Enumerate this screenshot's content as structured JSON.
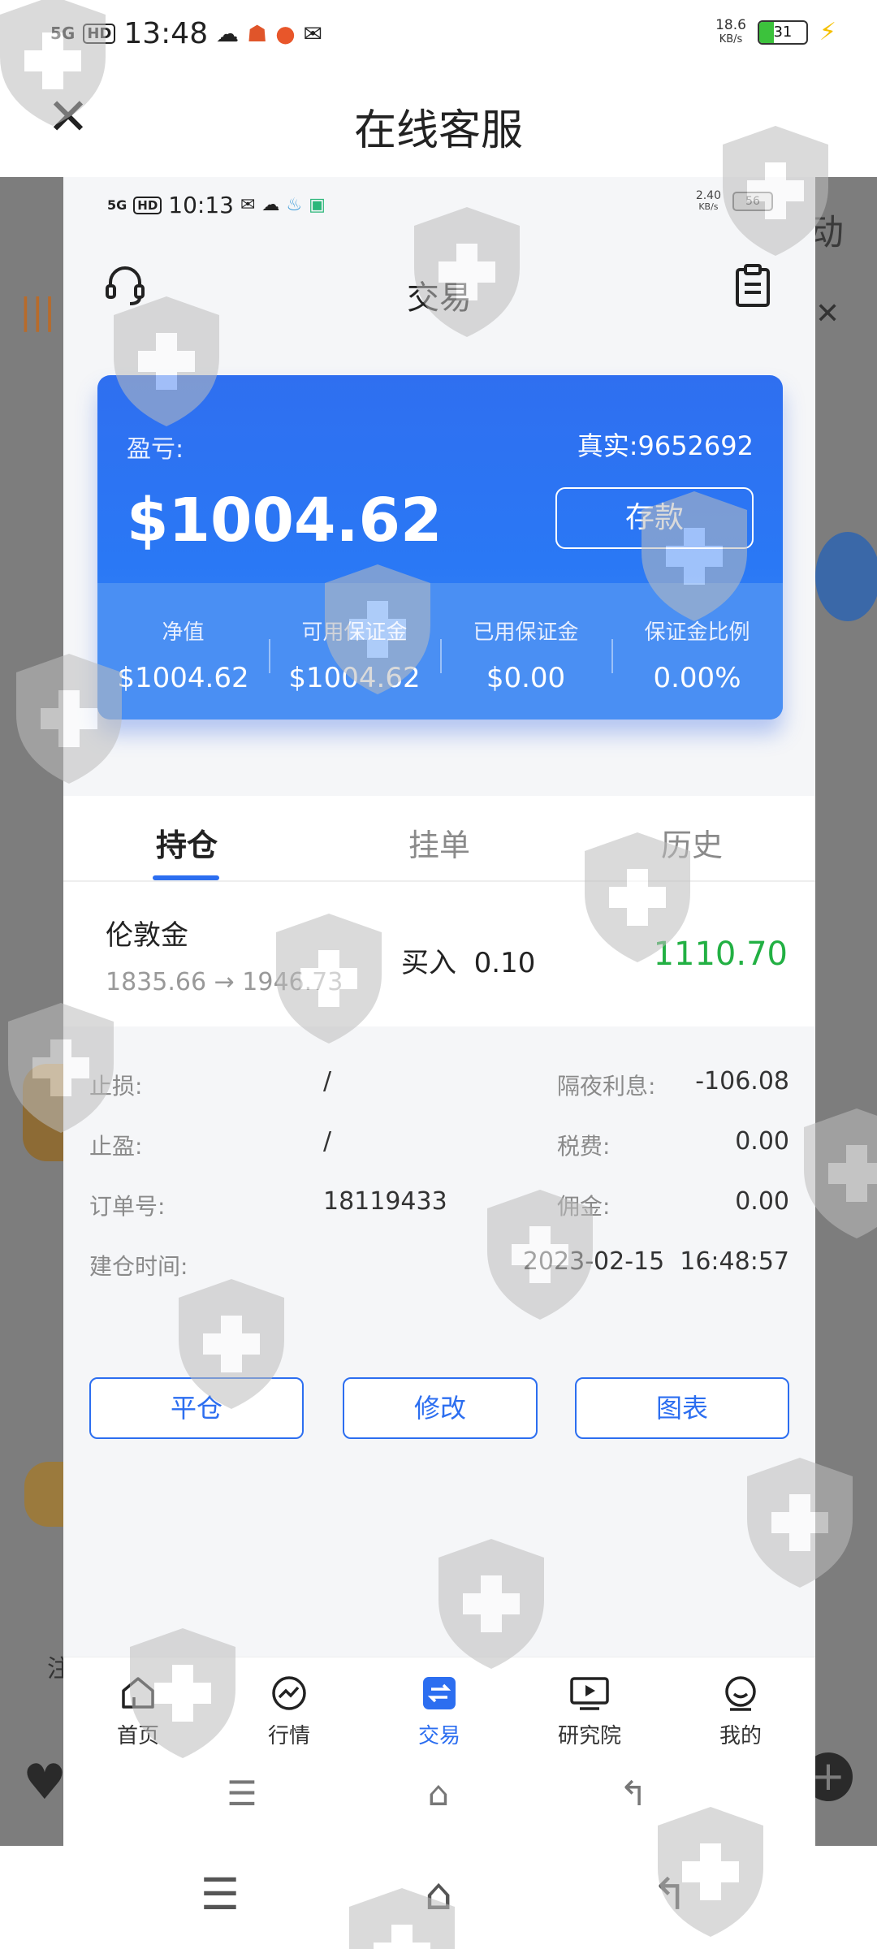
{
  "outer_status": {
    "network": "5G",
    "hd": "HD",
    "time": "13:48",
    "speed_value": "18.6",
    "speed_unit": "KB/s",
    "battery": "31"
  },
  "outer_header": {
    "title": "在线客服"
  },
  "background_page": {
    "right_fragment": "动",
    "note_fragment": "注"
  },
  "inner_status": {
    "network": "5G",
    "hd": "HD",
    "time": "10:13",
    "speed_value": "2.40",
    "speed_unit": "KB/s",
    "battery": "56"
  },
  "inner_header": {
    "title": "交易"
  },
  "account": {
    "pl_label": "盈亏:",
    "account_label": "真实:9652692",
    "pl_value": "$1004.62",
    "deposit_label": "存款",
    "stats": [
      {
        "label": "净值",
        "value": "$1004.62"
      },
      {
        "label": "可用保证金",
        "value": "$1004.62"
      },
      {
        "label": "已用保证金",
        "value": "$0.00"
      },
      {
        "label": "保证金比例",
        "value": "0.00%"
      }
    ]
  },
  "tabs": [
    {
      "label": "持仓"
    },
    {
      "label": "挂单"
    },
    {
      "label": "历史"
    }
  ],
  "position": {
    "name": "伦敦金",
    "prices": "1835.66 → 1946.73",
    "side": "买入",
    "lots": "0.10",
    "profit": "1110.70"
  },
  "details": {
    "stop_loss_label": "止损:",
    "stop_loss_value": "/",
    "take_profit_label": "止盈:",
    "take_profit_value": "/",
    "order_no_label": "订单号:",
    "order_no_value": "18119433",
    "open_time_label": "建仓时间:",
    "open_time_value": "2023-02-15  16:48:57",
    "swap_label": "隔夜利息:",
    "swap_value": "-106.08",
    "tax_label": "税费:",
    "tax_value": "0.00",
    "commission_label": "佣金:",
    "commission_value": "0.00"
  },
  "actions": {
    "close_label": "平仓",
    "modify_label": "修改",
    "chart_label": "图表"
  },
  "bottom_nav": [
    {
      "label": "首页",
      "icon": "home-icon"
    },
    {
      "label": "行情",
      "icon": "chart-icon"
    },
    {
      "label": "交易",
      "icon": "trade-icon"
    },
    {
      "label": "研究院",
      "icon": "video-icon"
    },
    {
      "label": "我的",
      "icon": "profile-icon"
    }
  ],
  "colors": {
    "accent": "#2c6ef0",
    "profit": "#22b043",
    "card_blue": "#2f6ff0"
  }
}
